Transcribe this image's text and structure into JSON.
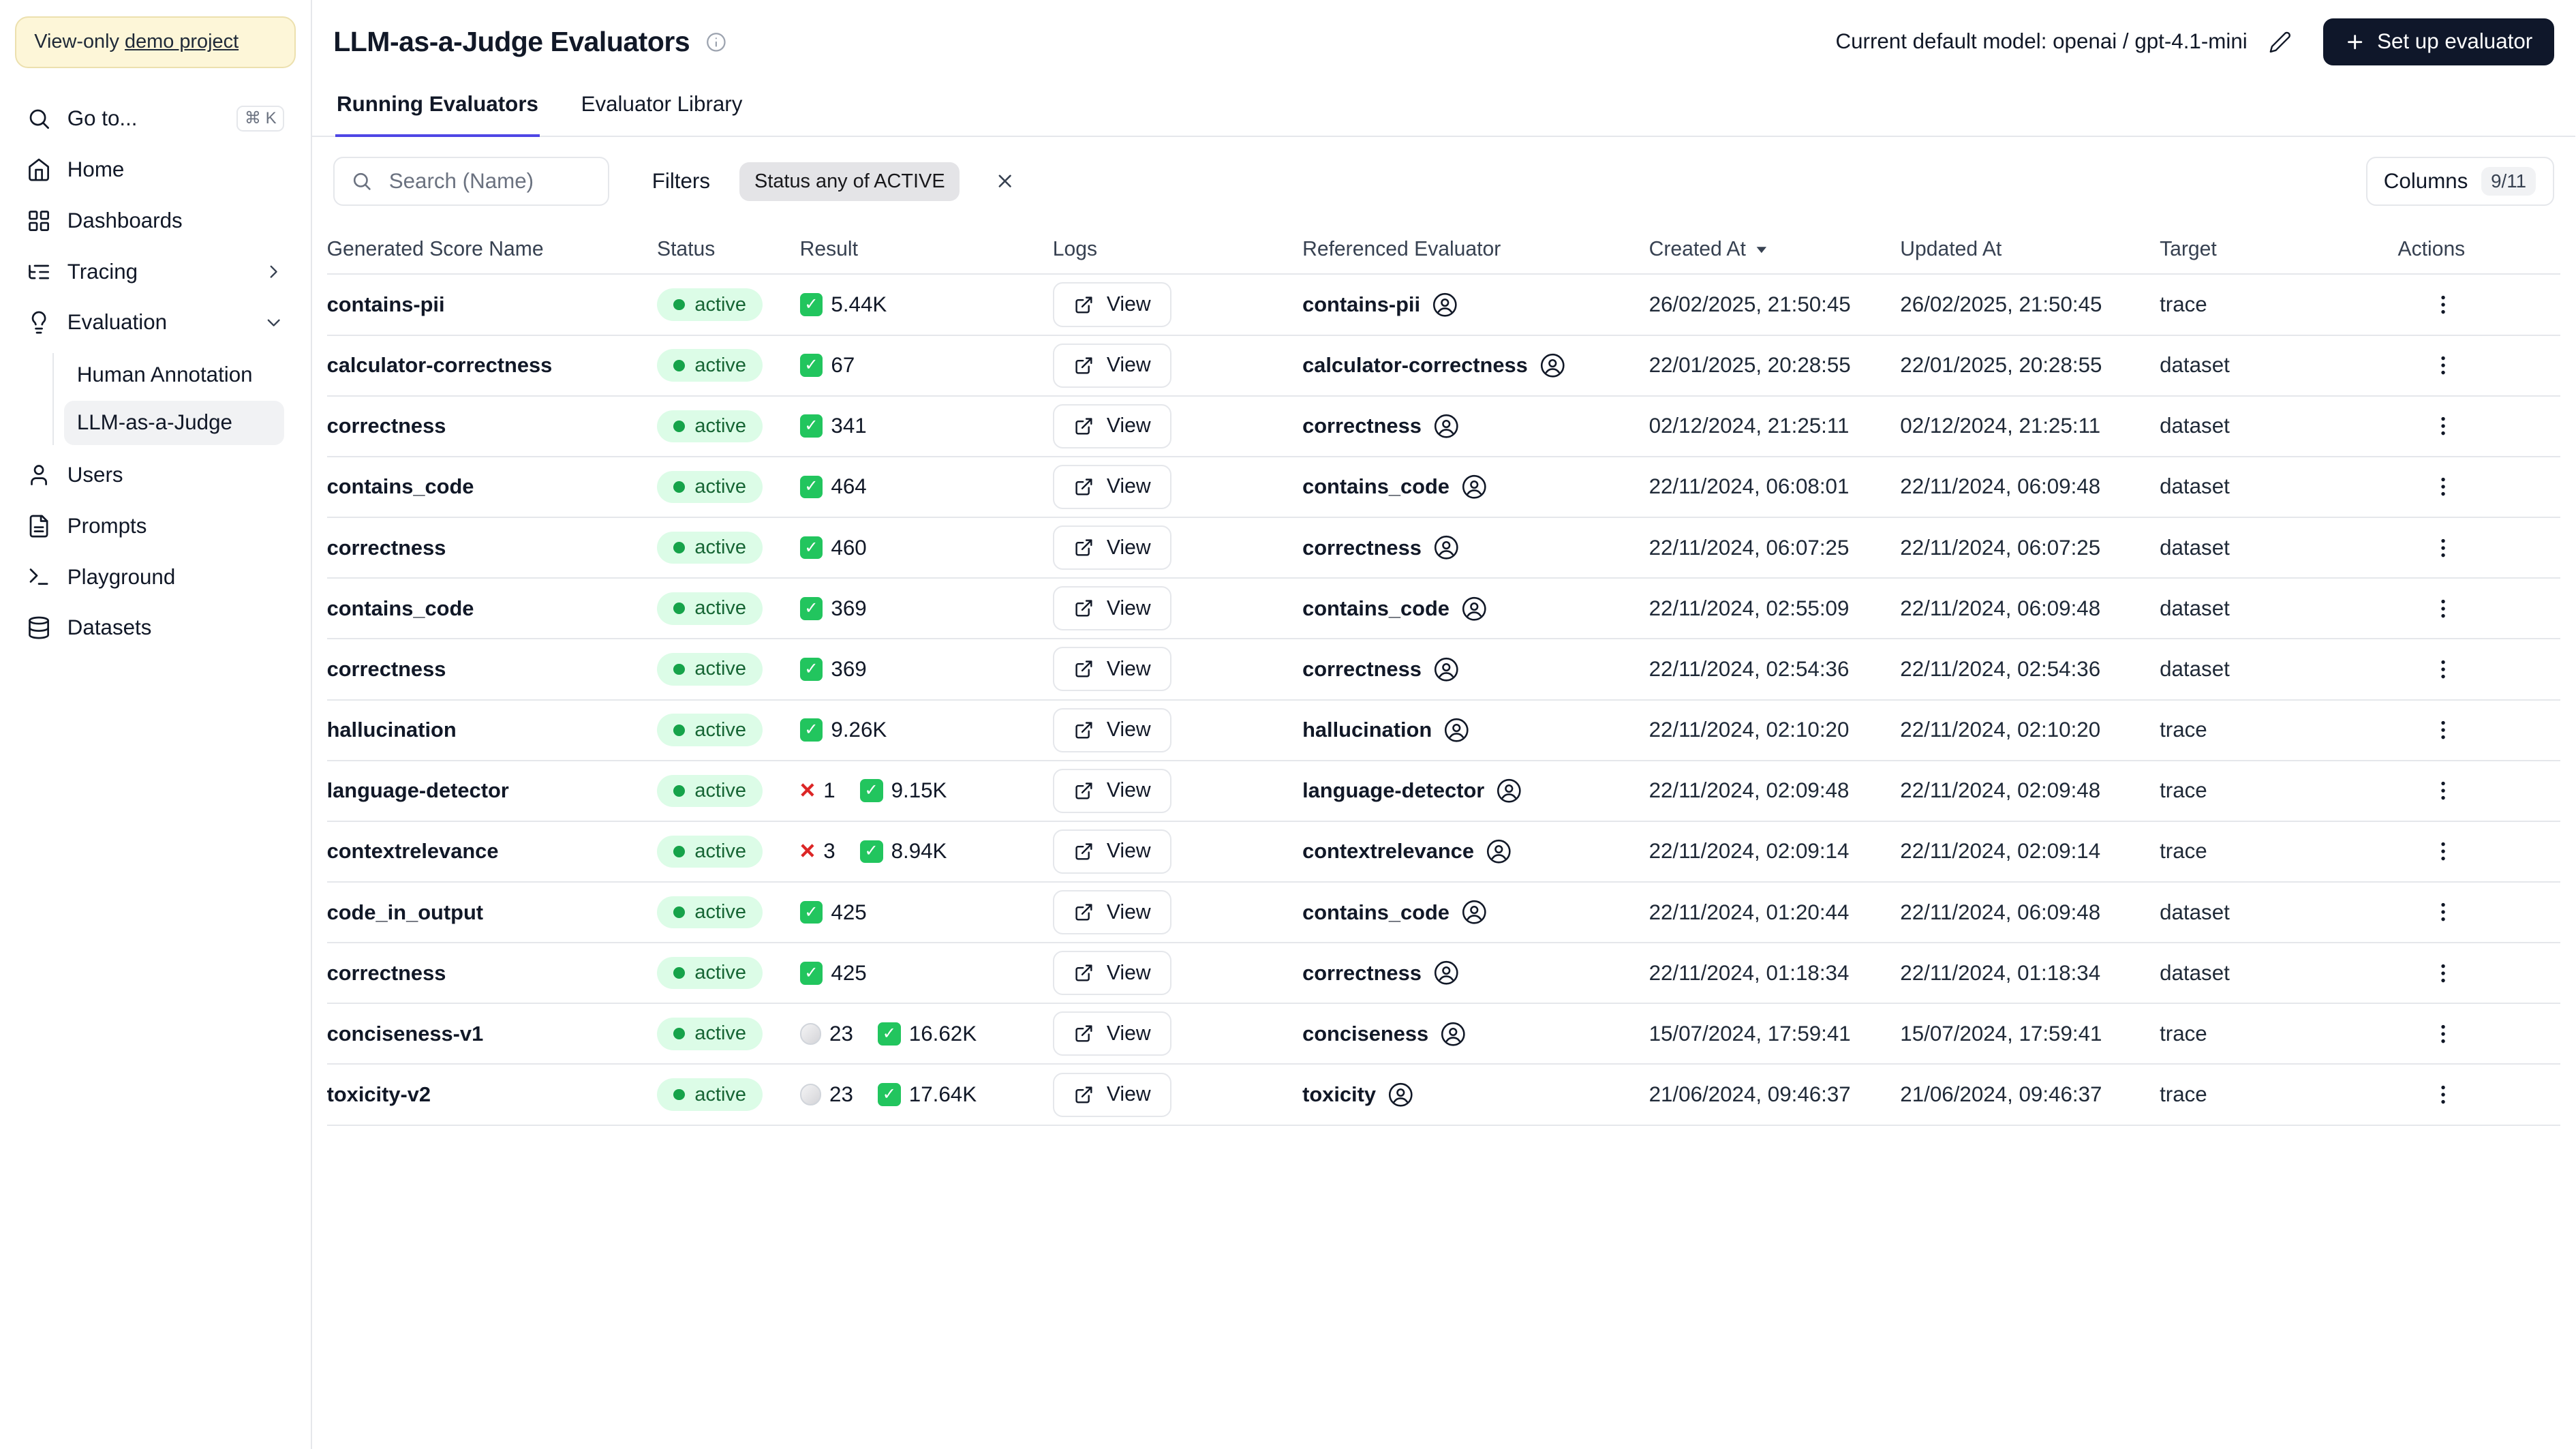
{
  "colors": {
    "accent": "#4f46e5",
    "status_active_bg": "#dcfce7",
    "status_active_text": "#166534",
    "status_dot": "#16a34a",
    "result_success": "#22c55e",
    "result_error": "#dc2626",
    "setup_button_bg": "#0f172a",
    "banner_bg": "#fdf6d8"
  },
  "sidebar": {
    "banner_prefix": "View-only ",
    "banner_link": "demo project",
    "goto": {
      "label": "Go to...",
      "shortcut": "⌘ K"
    },
    "items": {
      "home": "Home",
      "dashboards": "Dashboards",
      "tracing": "Tracing",
      "evaluation": "Evaluation",
      "human_annotation": "Human Annotation",
      "llm_judge": "LLM-as-a-Judge",
      "users": "Users",
      "prompts": "Prompts",
      "playground": "Playground",
      "datasets": "Datasets"
    }
  },
  "header": {
    "title": "LLM-as-a-Judge Evaluators",
    "model_label": "Current default model: openai / gpt-4.1-mini",
    "setup_button": "Set up evaluator"
  },
  "tabs": {
    "running": "Running Evaluators",
    "library": "Evaluator Library"
  },
  "toolbar": {
    "search_placeholder": "Search (Name)",
    "filters_label": "Filters",
    "filter_badge": "Status any of ACTIVE",
    "columns_label": "Columns",
    "columns_count": "9/11"
  },
  "table": {
    "columns": [
      "Generated Score Name",
      "Status",
      "Result",
      "Logs",
      "Referenced Evaluator",
      "Created At",
      "Updated At",
      "Target",
      "Actions"
    ],
    "sort_column": "Created At",
    "view_label": "View",
    "result_icons": {
      "success": "✓",
      "error": "×"
    },
    "rows": [
      {
        "name": "contains-pii",
        "status": "active",
        "results": [
          {
            "type": "success",
            "count": "5.44K"
          }
        ],
        "referenced": "contains-pii",
        "created": "26/02/2025, 21:50:45",
        "updated": "26/02/2025, 21:50:45",
        "target": "trace"
      },
      {
        "name": "calculator-correctness",
        "status": "active",
        "results": [
          {
            "type": "success",
            "count": "67"
          }
        ],
        "referenced": "calculator-correctness",
        "created": "22/01/2025, 20:28:55",
        "updated": "22/01/2025, 20:28:55",
        "target": "dataset"
      },
      {
        "name": "correctness",
        "status": "active",
        "results": [
          {
            "type": "success",
            "count": "341"
          }
        ],
        "referenced": "correctness",
        "created": "02/12/2024, 21:25:11",
        "updated": "02/12/2024, 21:25:11",
        "target": "dataset"
      },
      {
        "name": "contains_code",
        "status": "active",
        "results": [
          {
            "type": "success",
            "count": "464"
          }
        ],
        "referenced": "contains_code",
        "created": "22/11/2024, 06:08:01",
        "updated": "22/11/2024, 06:09:48",
        "target": "dataset"
      },
      {
        "name": "correctness",
        "status": "active",
        "results": [
          {
            "type": "success",
            "count": "460"
          }
        ],
        "referenced": "correctness",
        "created": "22/11/2024, 06:07:25",
        "updated": "22/11/2024, 06:07:25",
        "target": "dataset"
      },
      {
        "name": "contains_code",
        "status": "active",
        "results": [
          {
            "type": "success",
            "count": "369"
          }
        ],
        "referenced": "contains_code",
        "created": "22/11/2024, 02:55:09",
        "updated": "22/11/2024, 06:09:48",
        "target": "dataset"
      },
      {
        "name": "correctness",
        "status": "active",
        "results": [
          {
            "type": "success",
            "count": "369"
          }
        ],
        "referenced": "correctness",
        "created": "22/11/2024, 02:54:36",
        "updated": "22/11/2024, 02:54:36",
        "target": "dataset"
      },
      {
        "name": "hallucination",
        "status": "active",
        "results": [
          {
            "type": "success",
            "count": "9.26K"
          }
        ],
        "referenced": "hallucination",
        "created": "22/11/2024, 02:10:20",
        "updated": "22/11/2024, 02:10:20",
        "target": "trace"
      },
      {
        "name": "language-detector",
        "status": "active",
        "results": [
          {
            "type": "error",
            "count": "1"
          },
          {
            "type": "success",
            "count": "9.15K"
          }
        ],
        "referenced": "language-detector",
        "created": "22/11/2024, 02:09:48",
        "updated": "22/11/2024, 02:09:48",
        "target": "trace"
      },
      {
        "name": "contextrelevance",
        "status": "active",
        "results": [
          {
            "type": "error",
            "count": "3"
          },
          {
            "type": "success",
            "count": "8.94K"
          }
        ],
        "referenced": "contextrelevance",
        "created": "22/11/2024, 02:09:14",
        "updated": "22/11/2024, 02:09:14",
        "target": "trace"
      },
      {
        "name": "code_in_output",
        "status": "active",
        "results": [
          {
            "type": "success",
            "count": "425"
          }
        ],
        "referenced": "contains_code",
        "created": "22/11/2024, 01:20:44",
        "updated": "22/11/2024, 06:09:48",
        "target": "dataset"
      },
      {
        "name": "correctness",
        "status": "active",
        "results": [
          {
            "type": "success",
            "count": "425"
          }
        ],
        "referenced": "correctness",
        "created": "22/11/2024, 01:18:34",
        "updated": "22/11/2024, 01:18:34",
        "target": "dataset"
      },
      {
        "name": "conciseness-v1",
        "status": "active",
        "results": [
          {
            "type": "pending",
            "count": "23"
          },
          {
            "type": "success",
            "count": "16.62K"
          }
        ],
        "referenced": "conciseness",
        "created": "15/07/2024, 17:59:41",
        "updated": "15/07/2024, 17:59:41",
        "target": "trace"
      },
      {
        "name": "toxicity-v2",
        "status": "active",
        "results": [
          {
            "type": "pending",
            "count": "23"
          },
          {
            "type": "success",
            "count": "17.64K"
          }
        ],
        "referenced": "toxicity",
        "created": "21/06/2024, 09:46:37",
        "updated": "21/06/2024, 09:46:37",
        "target": "trace"
      }
    ]
  }
}
